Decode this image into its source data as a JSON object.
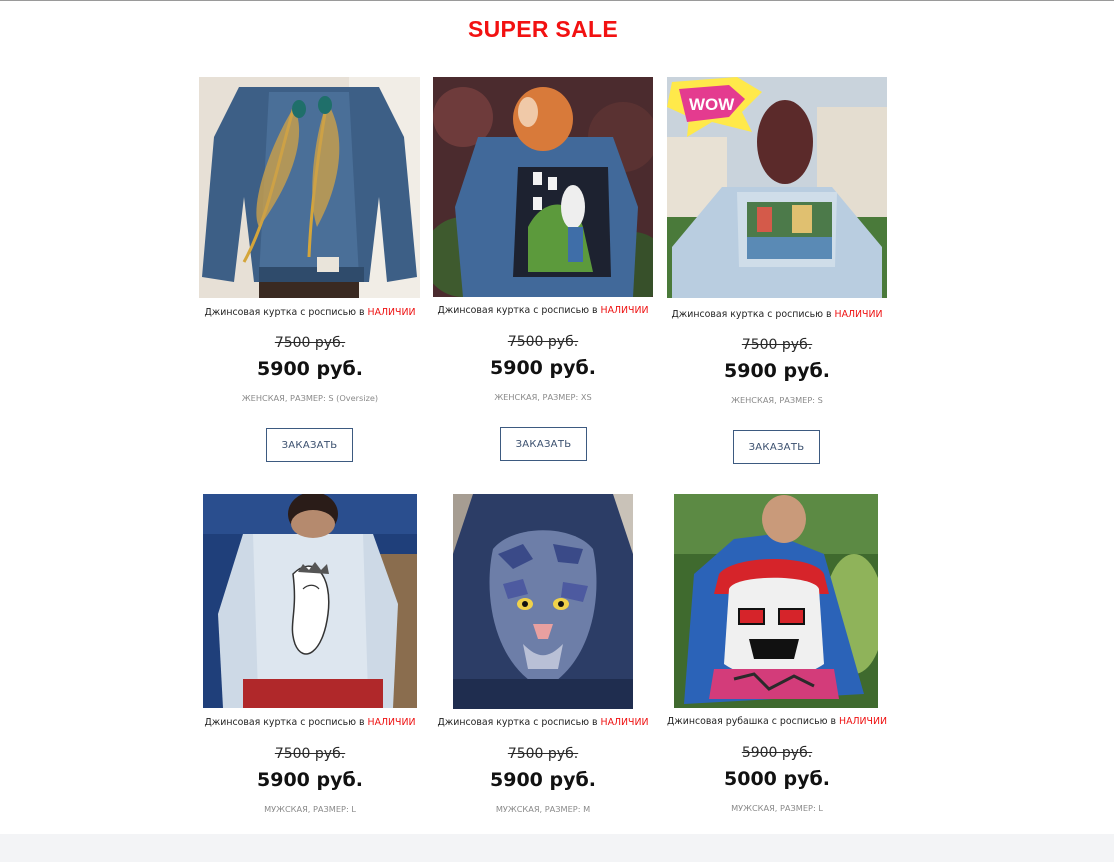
{
  "page": {
    "title": "SUPER SALE"
  },
  "products": [
    {
      "desc_main": "Джинсовая куртка с росписью в ",
      "desc_highlight": "НАЛИЧИИ",
      "old_price": "7500 руб.",
      "new_price": "5900 руб.",
      "meta": "ЖЕНСКАЯ, РАЗМЕР: S (Oversize)",
      "button": "ЗАКАЗАТЬ",
      "image": "denim-jacket-gold-peacock-feathers"
    },
    {
      "desc_main": "Джинсовая куртка с росписью в ",
      "desc_highlight": "НАЛИЧИИ",
      "old_price": "7500 руб.",
      "new_price": "5900 руб.",
      "meta": "ЖЕНСКАЯ, РАЗМЕР: XS",
      "button": "ЗАКАЗАТЬ",
      "image": "denim-jacket-white-rabbit-cards"
    },
    {
      "desc_main": "Джинсовая куртка с росписью в ",
      "desc_highlight": "НАЛИЧИИ",
      "old_price": "7500 руб.",
      "new_price": "5900 руб.",
      "meta": "ЖЕНСКАЯ, РАЗМЕР: S",
      "button": "ЗАКАЗАТЬ",
      "image": "light-denim-jacket-city-scene-wow"
    },
    {
      "desc_main": "Джинсовая куртка с росписью в ",
      "desc_highlight": "НАЛИЧИИ",
      "old_price": "7500 руб.",
      "new_price": "5900 руб.",
      "meta": "МУЖСКАЯ, РАЗМЕР: L",
      "image": "light-denim-jacket-queen-sketch"
    },
    {
      "desc_main": "Джинсовая куртка с росписью в ",
      "desc_highlight": "НАЛИЧИИ",
      "old_price": "7500 руб.",
      "new_price": "5900 руб.",
      "meta": "МУЖСКАЯ, РАЗМЕР: M",
      "image": "dark-denim-jacket-leopard"
    },
    {
      "desc_main": "Джинсовая рубашка с росписью в ",
      "desc_highlight": "НАЛИЧИИ",
      "old_price": "5900 руб.",
      "new_price": "5000 руб.",
      "meta": "МУЖСКАЯ, РАЗМЕР: L",
      "image": "denim-shirt-graffiti-skull"
    }
  ]
}
